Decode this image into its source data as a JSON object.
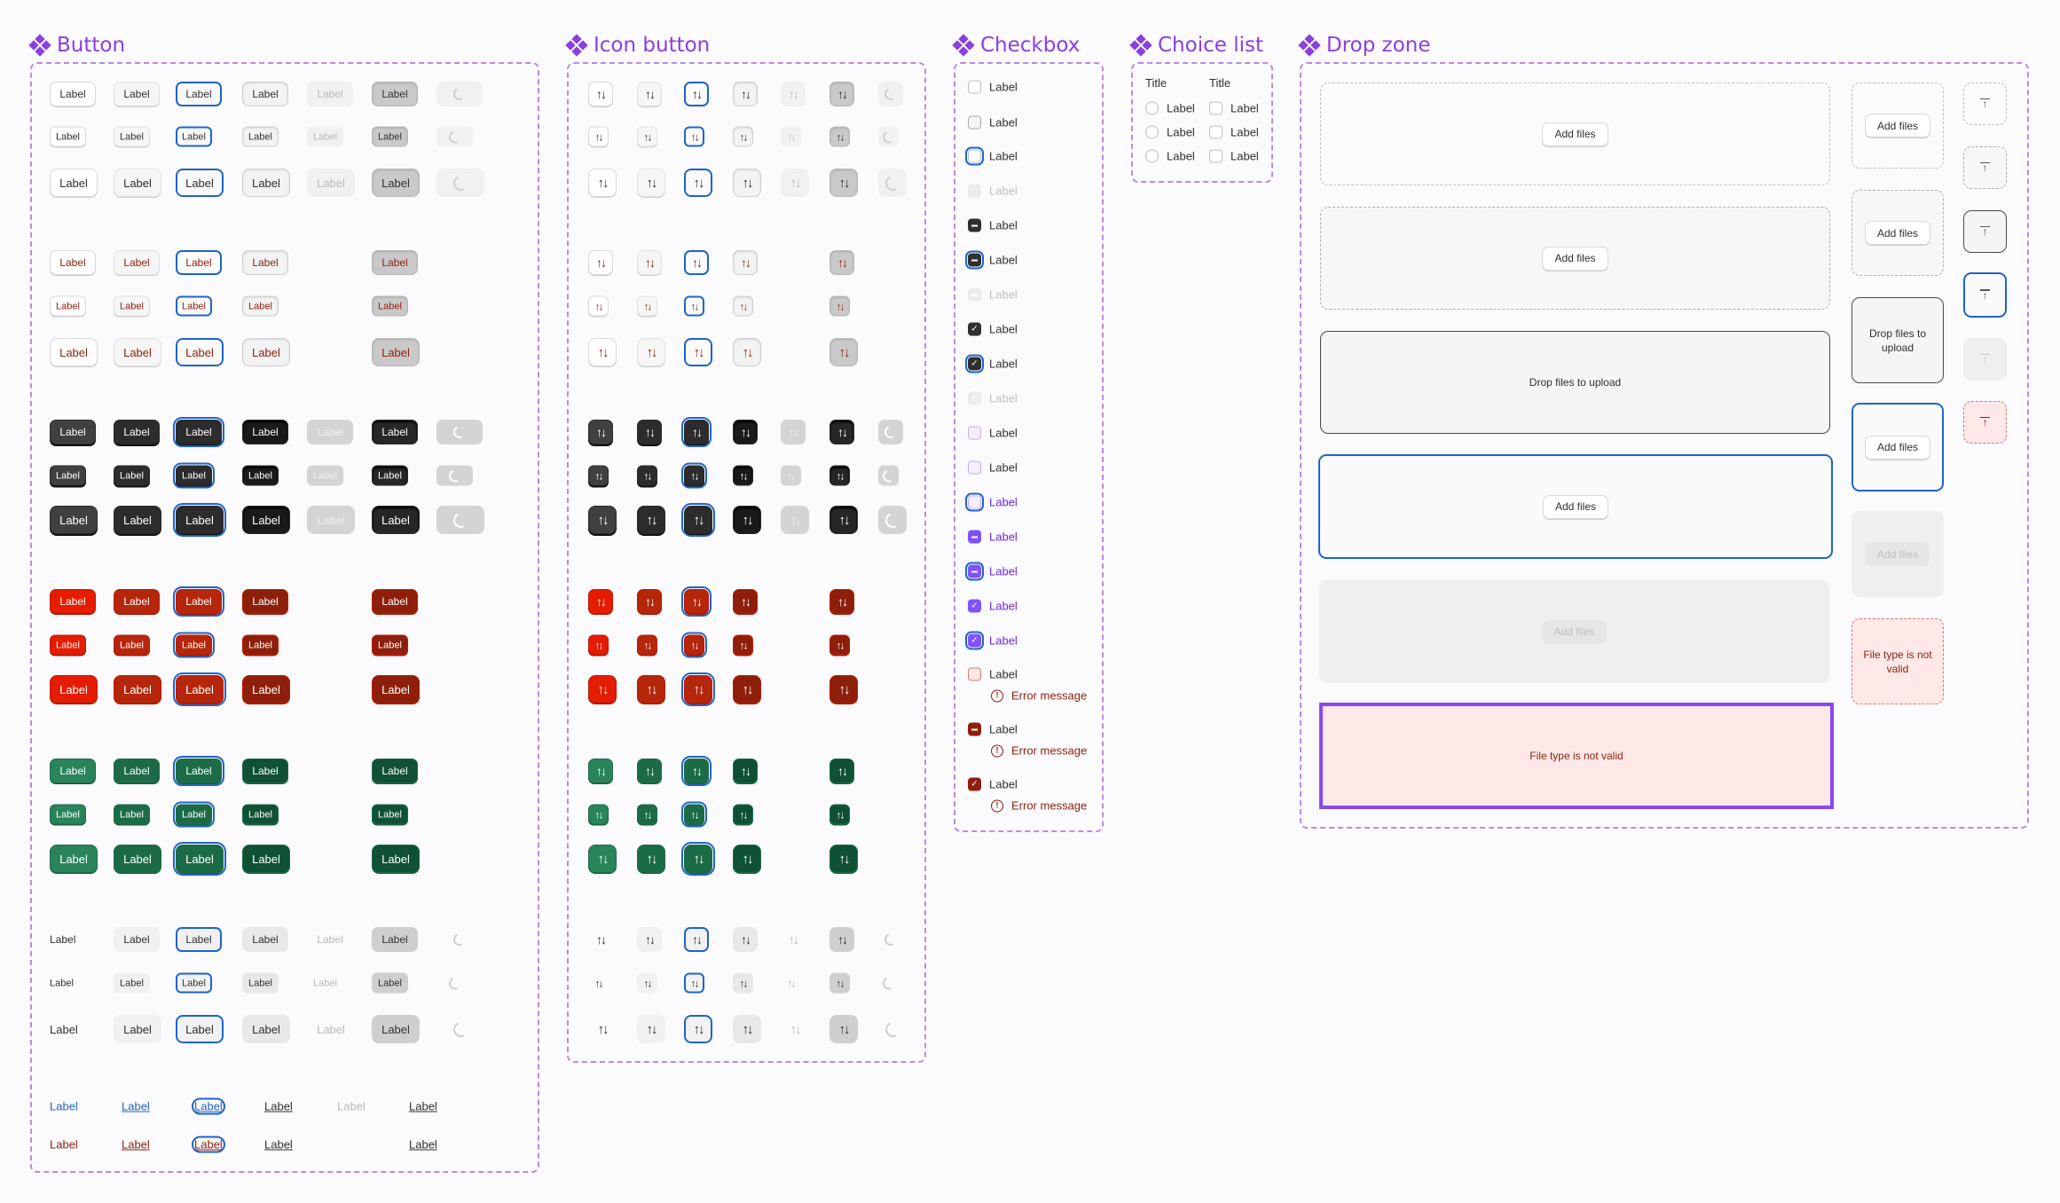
{
  "sections": {
    "button": {
      "title": "Button"
    },
    "icon_button": {
      "title": "Icon button"
    },
    "checkbox": {
      "title": "Checkbox"
    },
    "choice_list": {
      "title": "Choice list"
    },
    "drop_zone": {
      "title": "Drop zone"
    }
  },
  "button": {
    "label": "Label",
    "states": [
      "default",
      "hover",
      "focus",
      "pressed",
      "disabled",
      "selected",
      "loading"
    ],
    "groups": [
      {
        "variant": "secondary",
        "tone": "default",
        "has_disabled": true,
        "has_loading": true
      },
      {
        "variant": "secondary",
        "tone": "critical",
        "has_disabled": false,
        "has_loading": false
      },
      {
        "variant": "primary",
        "tone": "default",
        "has_disabled": true,
        "has_loading": true
      },
      {
        "variant": "primary",
        "tone": "critical",
        "has_disabled": false,
        "has_loading": false
      },
      {
        "variant": "primary",
        "tone": "success",
        "has_disabled": false,
        "has_loading": false
      },
      {
        "variant": "tertiary",
        "tone": "default",
        "has_disabled": true,
        "has_loading": true
      }
    ],
    "sizes": [
      "medium",
      "slim",
      "large"
    ],
    "links": {
      "label": "Label",
      "rows": [
        {
          "tone": "default",
          "states": [
            "default",
            "hover",
            "focus",
            "pressed",
            "disabled",
            "selected"
          ]
        },
        {
          "tone": "critical",
          "states": [
            "default",
            "hover",
            "focus",
            "pressed",
            "selected"
          ]
        }
      ]
    }
  },
  "icon_button": {
    "icon": "arrows-up-down-icon",
    "loading_icon": "spinner-icon"
  },
  "checkbox": {
    "label": "Label",
    "error_message": "Error message",
    "items": [
      {
        "state": "unchecked"
      },
      {
        "state": "unchecked-hover"
      },
      {
        "state": "unchecked-focus"
      },
      {
        "state": "unchecked-disabled"
      },
      {
        "state": "indeterminate"
      },
      {
        "state": "indeterminate-focus"
      },
      {
        "state": "indeterminate-disabled"
      },
      {
        "state": "checked"
      },
      {
        "state": "checked-focus"
      },
      {
        "state": "checked-disabled"
      },
      {
        "state": "brand-unchecked"
      },
      {
        "state": "brand-unchecked-hover"
      },
      {
        "state": "brand-unchecked-focus"
      },
      {
        "state": "brand-indeterminate"
      },
      {
        "state": "brand-indeterminate-focus"
      },
      {
        "state": "brand-checked"
      },
      {
        "state": "brand-checked-focus"
      },
      {
        "state": "error-unchecked"
      },
      {
        "state": "error-indeterminate"
      },
      {
        "state": "error-checked"
      }
    ]
  },
  "choice_list": {
    "columns": [
      {
        "title": "Title",
        "type": "radio",
        "options": [
          "Label",
          "Label",
          "Label"
        ]
      },
      {
        "title": "Title",
        "type": "checkbox",
        "options": [
          "Label",
          "Label",
          "Label"
        ]
      }
    ]
  },
  "drop_zone": {
    "add_files": "Add files",
    "drop_prompt": "Drop files to upload",
    "drop_prompt_wrapped": "Drop files to upload",
    "error_text": "File type is not valid",
    "upload_icon": "upload-icon",
    "large": [
      {
        "state": "default",
        "content": "Add files"
      },
      {
        "state": "hover",
        "content": "Add files"
      },
      {
        "state": "drag-over",
        "content": "Drop files to upload"
      },
      {
        "state": "focus",
        "content": "Add files"
      },
      {
        "state": "disabled",
        "content": "Add files"
      },
      {
        "state": "error-selected",
        "content": "File type is not valid"
      }
    ],
    "medium": [
      {
        "state": "default",
        "content": "Add files"
      },
      {
        "state": "hover",
        "content": "Add files"
      },
      {
        "state": "drag-over",
        "content": "Drop files to upload"
      },
      {
        "state": "focus",
        "content": "Add files"
      },
      {
        "state": "disabled",
        "content": "Add files"
      },
      {
        "state": "error",
        "content": "File type is not valid"
      }
    ],
    "small": [
      {
        "state": "default"
      },
      {
        "state": "hover"
      },
      {
        "state": "drag-over"
      },
      {
        "state": "focus"
      },
      {
        "state": "disabled"
      },
      {
        "state": "error"
      }
    ]
  },
  "colors": {
    "section_accent": "#8a3fe0",
    "focus_ring": "#1f64c8",
    "critical": "#e51c00",
    "critical_dark": "#8e1f0b",
    "success": "#29845a",
    "primary": "#303030",
    "brand": "#8051ff"
  }
}
